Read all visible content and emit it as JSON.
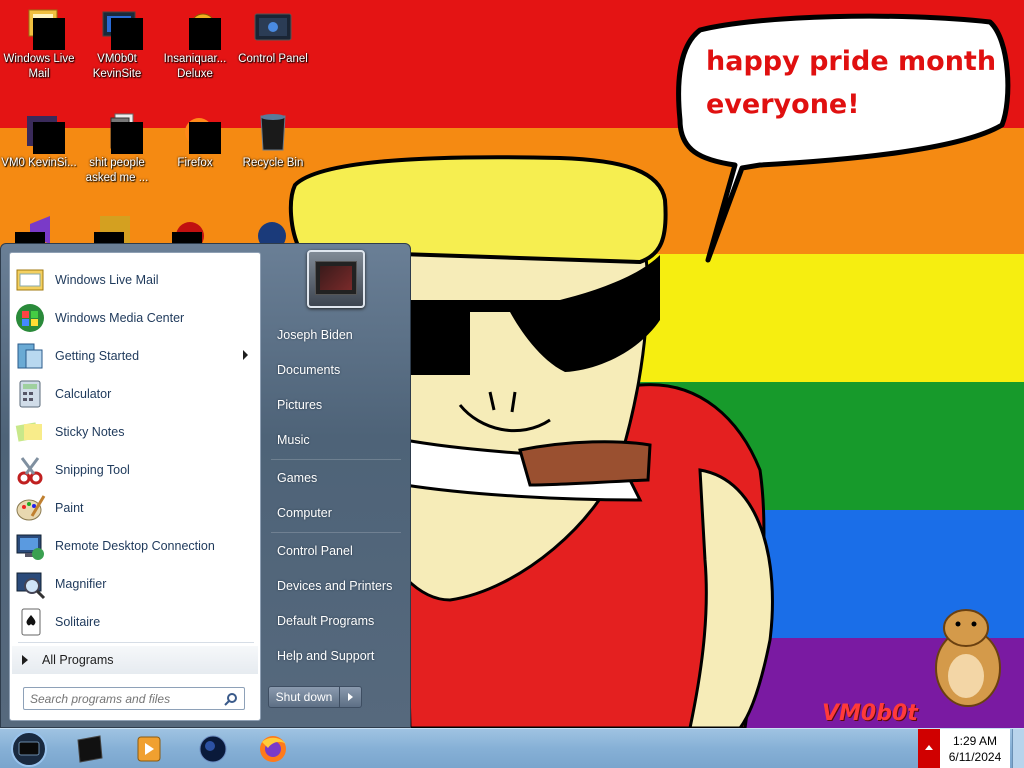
{
  "wallpaper": {
    "speech": [
      "happy pride month",
      "everyone!"
    ],
    "watermark": "VM0b0t"
  },
  "desktop_icons": [
    {
      "label": "Windows Live Mail",
      "icon": "windows-live-mail-icon"
    },
    {
      "label": "VM0b0t KevinSite",
      "icon": "monitor-icon"
    },
    {
      "label": "Insaniquar... Deluxe",
      "icon": "bonzi-icon"
    },
    {
      "label": "Control Panel",
      "icon": "control-panel-icon"
    },
    {
      "label": "VM0 KevinSi...",
      "icon": "vm-icon"
    },
    {
      "label": "shit people asked me ...",
      "icon": "document-icon"
    },
    {
      "label": "Firefox",
      "icon": "firefox-icon"
    },
    {
      "label": "Recycle Bin",
      "icon": "recycle-bin-icon"
    }
  ],
  "start_menu": {
    "programs": [
      {
        "label": "Windows Live Mail",
        "icon": "mail-icon"
      },
      {
        "label": "Windows Media Center",
        "icon": "media-center-icon"
      },
      {
        "label": "Getting Started",
        "icon": "getting-started-icon",
        "submenu": true
      },
      {
        "label": "Calculator",
        "icon": "calculator-icon"
      },
      {
        "label": "Sticky Notes",
        "icon": "sticky-notes-icon"
      },
      {
        "label": "Snipping Tool",
        "icon": "scissors-icon"
      },
      {
        "label": "Paint",
        "icon": "paint-icon"
      },
      {
        "label": "Remote Desktop Connection",
        "icon": "remote-desktop-icon"
      },
      {
        "label": "Magnifier",
        "icon": "magnifier-icon"
      },
      {
        "label": "Solitaire",
        "icon": "solitaire-icon"
      }
    ],
    "all_programs": "All Programs",
    "search_placeholder": "Search programs and files",
    "user_name": "Joseph Biden",
    "links": [
      "Documents",
      "Pictures",
      "Music",
      "Games",
      "Computer",
      "Control Panel",
      "Devices and Printers",
      "Default Programs",
      "Help and Support"
    ],
    "shutdown_label": "Shut down"
  },
  "taskbar": {
    "items": [
      "vm-icon",
      "media-player-icon",
      "globe-icon",
      "firefox-icon"
    ],
    "time": "1:29 AM",
    "date": "6/11/2024"
  }
}
